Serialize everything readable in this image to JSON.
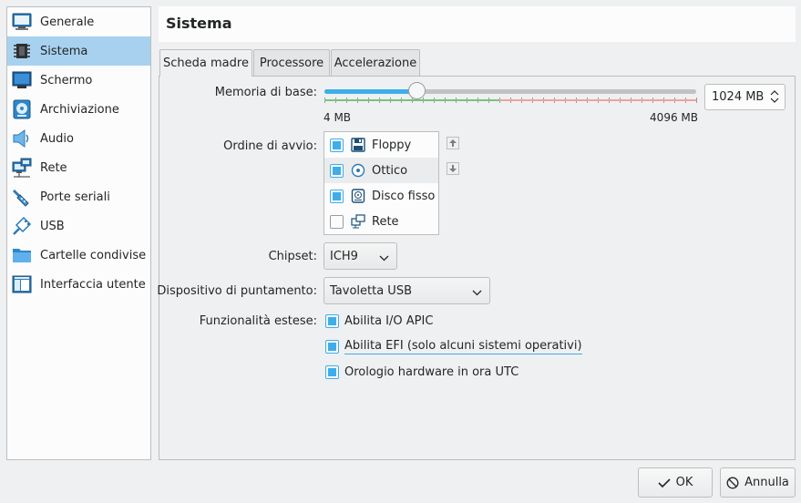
{
  "sidebar": {
    "items": [
      {
        "label": "Generale",
        "icon": "monitor-general-icon"
      },
      {
        "label": "Sistema",
        "icon": "chip-icon"
      },
      {
        "label": "Schermo",
        "icon": "display-icon"
      },
      {
        "label": "Archiviazione",
        "icon": "disk-storage-icon"
      },
      {
        "label": "Audio",
        "icon": "speaker-icon"
      },
      {
        "label": "Rete",
        "icon": "network-icon"
      },
      {
        "label": "Porte seriali",
        "icon": "serial-port-icon"
      },
      {
        "label": "USB",
        "icon": "usb-icon"
      },
      {
        "label": "Cartelle condivise",
        "icon": "folder-icon"
      },
      {
        "label": "Interfaccia utente",
        "icon": "ui-window-icon"
      }
    ],
    "selected": "Sistema"
  },
  "header": {
    "title": "Sistema"
  },
  "tabs": [
    {
      "label": "Scheda madre",
      "active": true
    },
    {
      "label": "Processore",
      "active": false
    },
    {
      "label": "Accelerazione",
      "active": false
    }
  ],
  "motherboard": {
    "memory_label": "Memoria di base:",
    "memory_min": "4 MB",
    "memory_max": "4096 MB",
    "memory_value": "1024 MB",
    "memory_fraction": 0.25,
    "boot_order_label": "Ordine di avvio:",
    "boot_items": [
      {
        "label": "Floppy",
        "checked": true,
        "icon": "floppy-icon"
      },
      {
        "label": "Ottico",
        "checked": true,
        "icon": "optical-disc-icon"
      },
      {
        "label": "Disco fisso",
        "checked": true,
        "icon": "hard-disk-icon"
      },
      {
        "label": "Rete",
        "checked": false,
        "icon": "network-boot-icon"
      }
    ],
    "chipset_label": "Chipset:",
    "chipset_value": "ICH9",
    "pointing_label": "Dispositivo di puntamento:",
    "pointing_value": "Tavoletta USB",
    "ext_label": "Funzionalità estese:",
    "ext_items": [
      {
        "label": "Abilita I/O APIC",
        "checked": true
      },
      {
        "label": "Abilita EFI (solo alcuni sistemi operativi)",
        "checked": true
      },
      {
        "label": "Orologio hardware in ora UTC",
        "checked": true
      }
    ]
  },
  "footer": {
    "ok_label": "OK",
    "cancel_label": "Annulla"
  },
  "colors": {
    "accent": "#3daee9",
    "selected_bg": "#a8d1ef",
    "good_zone": "#78c478",
    "bad_zone": "#f0a0a0"
  }
}
